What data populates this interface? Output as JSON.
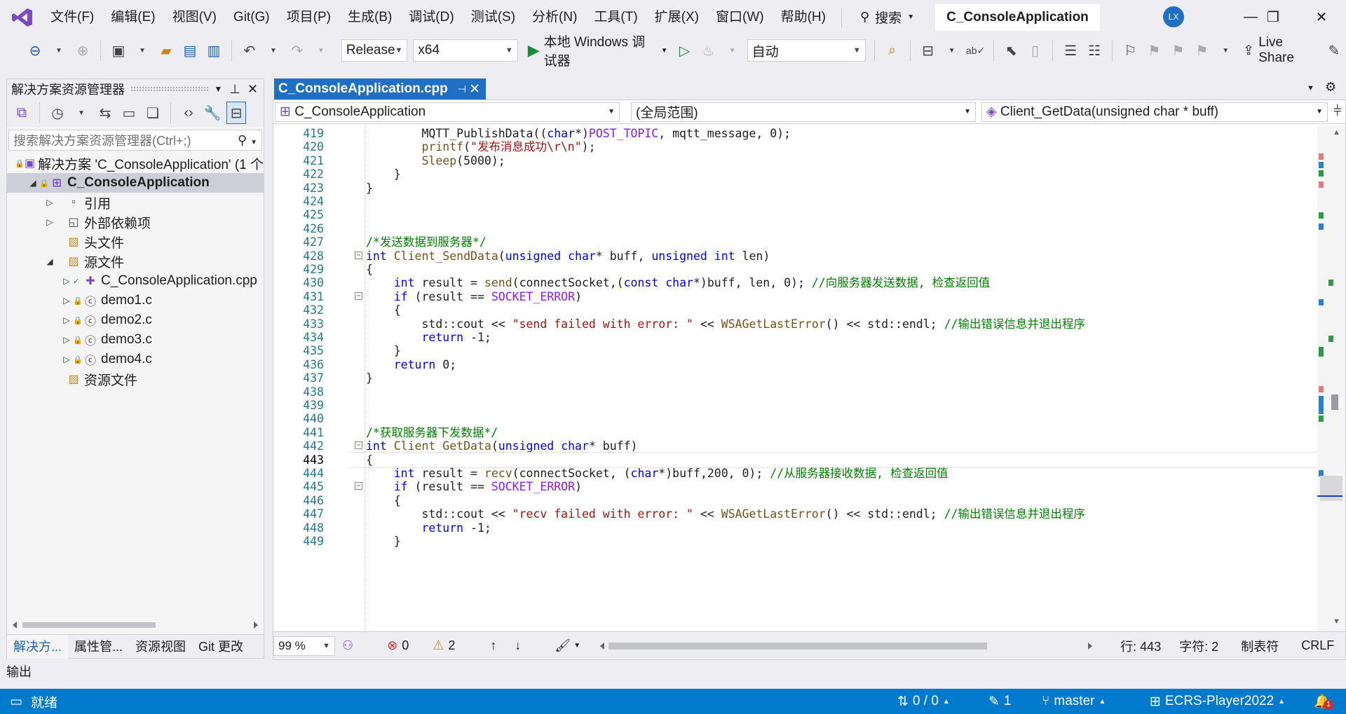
{
  "menu": [
    "文件(F)",
    "编辑(E)",
    "视图(V)",
    "Git(G)",
    "项目(P)",
    "生成(B)",
    "调试(D)",
    "测试(S)",
    "分析(N)",
    "工具(T)",
    "扩展(X)",
    "窗口(W)",
    "帮助(H)"
  ],
  "search_label": "搜索",
  "solution_title": "C_ConsoleApplication",
  "avatar_initials": "LX",
  "toolbar": {
    "config": "Release",
    "platform": "x64",
    "debugger_label": "本地 Windows 调试器",
    "auto_combo": "自动",
    "live_share": "Live Share"
  },
  "solution_explorer": {
    "title": "解决方案资源管理器",
    "search_placeholder": "搜索解决方案资源管理器(Ctrl+;)",
    "tree": [
      {
        "label": "解决方案 'C_ConsoleApplication' (1 个",
        "indent": 0,
        "chevron": "",
        "icon": "solution-icon"
      },
      {
        "label": "C_ConsoleApplication",
        "indent": 1,
        "chevron": "◢",
        "icon": "project-icon"
      },
      {
        "label": "引用",
        "indent": 2,
        "chevron": "▷",
        "icon": "references-icon"
      },
      {
        "label": "外部依赖项",
        "indent": 2,
        "chevron": "▷",
        "icon": "external-deps-icon"
      },
      {
        "label": "头文件",
        "indent": 2,
        "chevron": "",
        "icon": "filter-folder-icon"
      },
      {
        "label": "源文件",
        "indent": 2,
        "chevron": "◢",
        "icon": "filter-folder-icon"
      },
      {
        "label": "C_ConsoleApplication.cpp",
        "indent": 3,
        "chevron": "▷",
        "icon": "cpp-file-icon"
      },
      {
        "label": "demo1.c",
        "indent": 3,
        "chevron": "▷",
        "icon": "c-file-icon"
      },
      {
        "label": "demo2.c",
        "indent": 3,
        "chevron": "▷",
        "icon": "c-file-icon"
      },
      {
        "label": "demo3.c",
        "indent": 3,
        "chevron": "▷",
        "icon": "c-file-icon"
      },
      {
        "label": "demo4.c",
        "indent": 3,
        "chevron": "▷",
        "icon": "c-file-icon"
      },
      {
        "label": "资源文件",
        "indent": 2,
        "chevron": "",
        "icon": "filter-folder-icon"
      }
    ],
    "tabs": [
      "解决方...",
      "属性管...",
      "资源视图",
      "Git 更改"
    ]
  },
  "editor": {
    "tab_label": "C_ConsoleApplication.cpp",
    "nav_project": "C_ConsoleApplication",
    "nav_scope": "(全局范围)",
    "nav_member": "Client_GetData(unsigned char * buff)",
    "lines": [
      {
        "n": "419",
        "html": "        MQTT_PublishData((<span class='kw'>char</span>*)<span class='mc'>POST_TOPIC</span>, mqtt_message, 0);"
      },
      {
        "n": "420",
        "html": "        <span class='fn'>printf</span>(<span class='st'>\"发布消息成功\\r\\n\"</span>);"
      },
      {
        "n": "421",
        "html": "        <span class='fn'>Sleep</span>(5000);"
      },
      {
        "n": "422",
        "html": "    }"
      },
      {
        "n": "423",
        "html": "}"
      },
      {
        "n": "424",
        "html": ""
      },
      {
        "n": "425",
        "html": ""
      },
      {
        "n": "426",
        "html": ""
      },
      {
        "n": "427",
        "html": "<span class='cm'>/*发送数据到服务器*/</span>"
      },
      {
        "n": "428",
        "html": "<span class='kw'>int</span> <span class='fn'>Client_SendData</span>(<span class='kw'>unsigned</span> <span class='kw'>char</span>* buff, <span class='kw'>unsigned</span> <span class='kw'>int</span> len)",
        "fold": true
      },
      {
        "n": "429",
        "html": "{"
      },
      {
        "n": "430",
        "html": "    <span class='kw'>int</span> result = <span class='fn'>send</span>(connectSocket,(<span class='kw'>const</span> <span class='kw'>char</span>*)buff, len, 0); <span class='cm'>//向服务器发送数据, 检查返回值</span>"
      },
      {
        "n": "431",
        "html": "    <span class='kw'>if</span> (result == <span class='mc'>SOCKET_ERROR</span>)",
        "fold": true
      },
      {
        "n": "432",
        "html": "    {"
      },
      {
        "n": "433",
        "html": "        std::cout << <span class='st'>\"send failed with error: \"</span> << <span class='fn'>WSAGetLastError</span>() << std::endl; <span class='cm'>//输出错误信息并退出程序</span>"
      },
      {
        "n": "434",
        "html": "        <span class='kw'>return</span> -1;"
      },
      {
        "n": "435",
        "html": "    }"
      },
      {
        "n": "436",
        "html": "    <span class='kw'>return</span> 0;"
      },
      {
        "n": "437",
        "html": "}"
      },
      {
        "n": "438",
        "html": ""
      },
      {
        "n": "439",
        "html": ""
      },
      {
        "n": "440",
        "html": ""
      },
      {
        "n": "441",
        "html": "<span class='cm'>/*获取服务器下发数据*/</span>"
      },
      {
        "n": "442",
        "html": "<span class='kw'>int</span> <span class='fn'>Client_GetData</span>(<span class='kw'>unsigned</span> <span class='kw'>char</span>* buff)",
        "fold": true
      },
      {
        "n": "443",
        "html": "{",
        "current": true
      },
      {
        "n": "444",
        "html": "    <span class='kw'>int</span> result = <span class='fn'>recv</span>(connectSocket, (<span class='kw'>char</span>*)buff,200, 0); <span class='cm'>//从服务器接收数据, 检查返回值</span>"
      },
      {
        "n": "445",
        "html": "    <span class='kw'>if</span> (result == <span class='mc'>SOCKET_ERROR</span>)",
        "fold": true
      },
      {
        "n": "446",
        "html": "    {"
      },
      {
        "n": "447",
        "html": "        std::cout << <span class='st'>\"recv failed with error: \"</span> << <span class='fn'>WSAGetLastError</span>() << std::endl; <span class='cm'>//输出错误信息并退出程序</span>"
      },
      {
        "n": "448",
        "html": "        <span class='kw'>return</span> -1;"
      },
      {
        "n": "449",
        "html": "    }"
      }
    ],
    "zoom": "99 %",
    "errors": "0",
    "warnings": "2",
    "line_info": "行: 443",
    "col_info": "字符: 2",
    "indent_mode": "制表符",
    "eol": "CRLF"
  },
  "output_title": "输出",
  "status": {
    "ready": "就绪",
    "sync": "0 / 0",
    "changes": "1",
    "branch": "master",
    "repo": "ECRS-Player2022",
    "notifications": "1"
  },
  "colors": {
    "accent": "#007acc",
    "tab_active": "#1f6fc4"
  }
}
